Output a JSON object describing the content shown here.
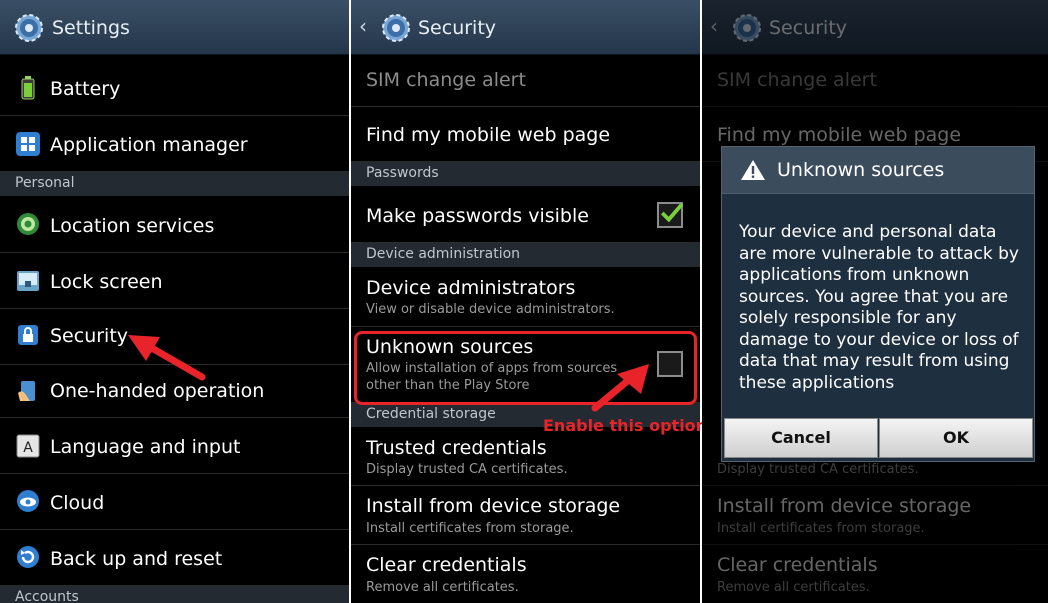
{
  "colors": {
    "accent_red": "#e8232a",
    "action_bar": "#2f4257",
    "category_bg": "#232a31",
    "check_green": "#7ad03a"
  },
  "panel1": {
    "title": "Settings",
    "items": [
      {
        "label": "Battery",
        "icon": "battery-icon"
      },
      {
        "label": "Application manager",
        "icon": "app-grid-icon"
      },
      {
        "label": "Location services",
        "icon": "location-icon"
      },
      {
        "label": "Lock screen",
        "icon": "lock-screen-icon"
      },
      {
        "label": "Security",
        "icon": "padlock-icon"
      },
      {
        "label": "One-handed operation",
        "icon": "hand-icon"
      },
      {
        "label": "Language and input",
        "icon": "keyboard-icon"
      },
      {
        "label": "Cloud",
        "icon": "cloud-icon"
      },
      {
        "label": "Back up and reset",
        "icon": "reset-icon"
      }
    ],
    "categories": [
      "Personal",
      "Accounts"
    ]
  },
  "panel2": {
    "title": "Security",
    "sim_change_alert": "SIM change alert",
    "find_my_mobile": "Find my mobile web page",
    "cat_passwords": "Passwords",
    "make_passwords_visible": "Make passwords visible",
    "make_passwords_visible_checked": true,
    "cat_device_admin": "Device administration",
    "device_administrators": "Device administrators",
    "device_administrators_sub": "View or disable device administrators.",
    "unknown_sources": "Unknown sources",
    "unknown_sources_sub1": "Allow installation of apps from sources",
    "unknown_sources_sub2": "other than the Play Store",
    "unknown_sources_checked": false,
    "cat_credential_storage": "Credential storage",
    "trusted_credentials": "Trusted credentials",
    "trusted_credentials_sub": "Display trusted CA certificates.",
    "install_from_storage": "Install from device storage",
    "install_from_storage_sub": "Install certificates from storage.",
    "clear_credentials": "Clear credentials",
    "clear_credentials_sub": "Remove all certificates."
  },
  "annotation": {
    "text": "Enable this option"
  },
  "panel3": {
    "title": "Security",
    "sim_change_alert": "SIM change alert",
    "find_my_mobile": "Find my mobile web page",
    "trusted_credentials_sub": "Display trusted CA certificates.",
    "install_from_storage": "Install from device storage",
    "install_from_storage_sub": "Install certificates from storage.",
    "clear_credentials": "Clear credentials",
    "clear_credentials_sub": "Remove all certificates.",
    "dialog": {
      "title": "Unknown sources",
      "message_lines": [
        "Your device and personal data",
        "are more vulnerable to attack by",
        "applications from unknown",
        "sources. You agree that you are",
        "solely responsible for any",
        "damage to your device or loss of",
        "data that may result from using",
        "these applications"
      ],
      "cancel": "Cancel",
      "ok": "OK"
    }
  }
}
